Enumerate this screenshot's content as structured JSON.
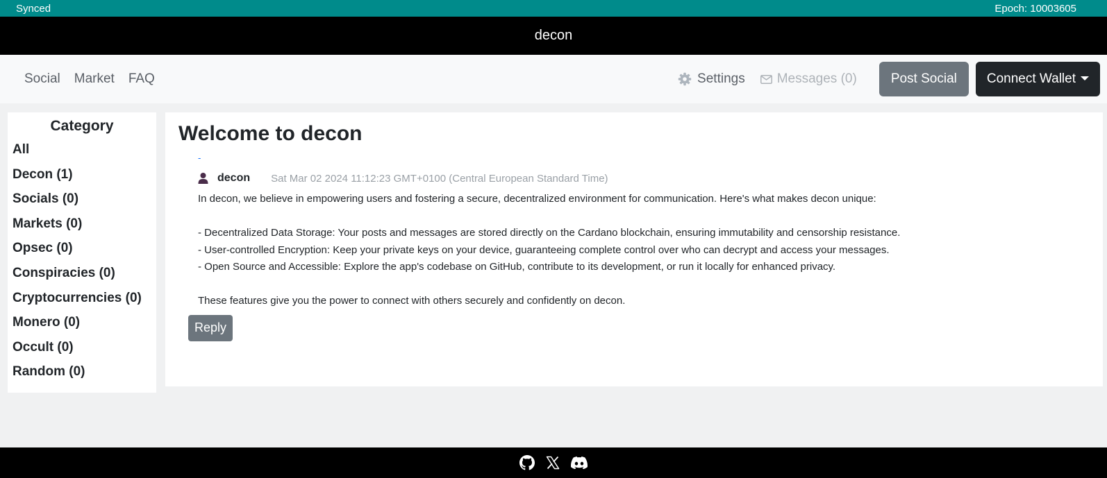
{
  "statusbar": {
    "sync_status": "Synced",
    "epoch": "Epoch: 10003605"
  },
  "title": "decon",
  "nav": {
    "links": [
      "Social",
      "Market",
      "FAQ"
    ],
    "settings_label": "Settings",
    "messages_label": "Messages (0)",
    "post_social_label": "Post Social",
    "connect_wallet_label": "Connect Wallet"
  },
  "sidebar": {
    "heading": "Category",
    "items": [
      {
        "label": "All"
      },
      {
        "label": "Decon (1)"
      },
      {
        "label": "Socials (0)"
      },
      {
        "label": "Markets (0)"
      },
      {
        "label": "Opsec (0)"
      },
      {
        "label": "Conspiracies (0)"
      },
      {
        "label": "Cryptocurrencies (0)"
      },
      {
        "label": "Monero (0)"
      },
      {
        "label": "Occult (0)"
      },
      {
        "label": "Random (0)"
      }
    ]
  },
  "main": {
    "heading": "Welcome to decon",
    "link_text": "-",
    "post": {
      "author": "decon",
      "timestamp": "Sat Mar 02 2024 11:12:23 GMT+0100 (Central European Standard Time)",
      "intro": "In decon, we believe in empowering users and fostering a secure, decentralized environment for communication. Here's what makes decon unique:",
      "bullets": [
        "- Decentralized Data Storage: Your posts and messages are stored directly on the Cardano blockchain, ensuring immutability and censorship resistance.",
        "- User-controlled Encryption: Keep your private keys on your device, guaranteeing complete control over who can decrypt and access your messages.",
        "- Open Source and Accessible: Explore the app's codebase on GitHub, contribute to its development, or run it locally for enhanced privacy."
      ],
      "closing": "These features give you the power to connect with others securely and confidently on decon."
    },
    "reply_label": "Reply"
  },
  "footer": {
    "icons": [
      "github-icon",
      "x-icon",
      "discord-icon"
    ]
  },
  "colors": {
    "statusbar": "#008b8b",
    "header": "#000000",
    "secondary": "#6c757d",
    "dark_button": "#212529",
    "user_icon": "#4a2d4a"
  }
}
